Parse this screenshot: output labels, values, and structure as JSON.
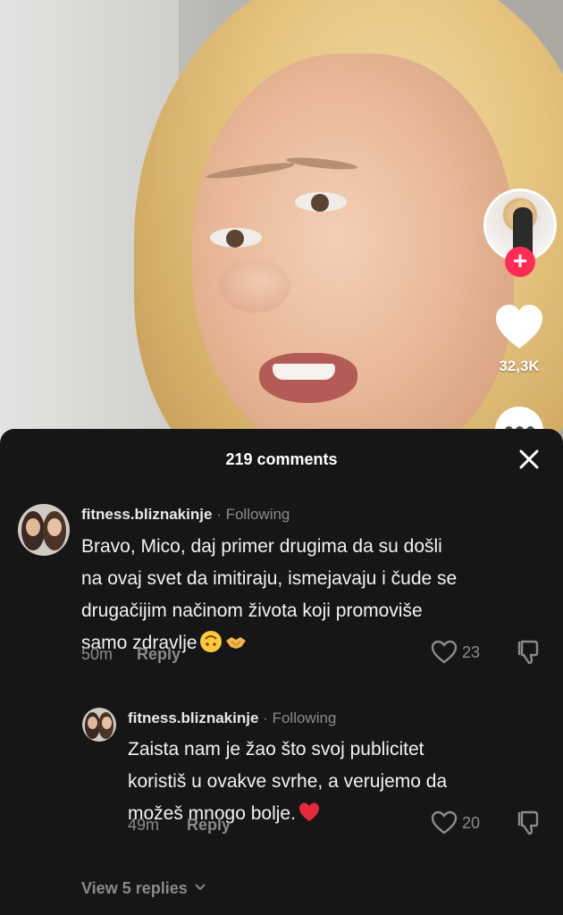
{
  "video": {
    "like_count": "32,3K"
  },
  "comments_sheet": {
    "count_label": "219 comments",
    "comments": [
      {
        "username": "fitness.bliznakinje",
        "separator": "·",
        "relation": "Following",
        "lines": [
          "Bravo, Mico, daj primer drugima da su došli",
          "na ovaj svet da imitiraju, ismejavaju i čude se",
          "drugačijim načinom života koji promoviše",
          "samo zdravlje"
        ],
        "emojis": [
          "upside-down-face",
          "handshake"
        ],
        "time": "50m",
        "reply_label": "Reply",
        "likes": "23"
      },
      {
        "username": "fitness.bliznakinje",
        "separator": "·",
        "relation": "Following",
        "lines": [
          "Zaista nam je žao što svoj publicitet",
          "koristiš u ovakve svrhe, a verujemo da",
          "možeš mnogo bolje."
        ],
        "emojis": [
          "red-heart"
        ],
        "time": "49m",
        "reply_label": "Reply",
        "likes": "20"
      }
    ],
    "view_replies_label": "View 5 replies"
  },
  "colors": {
    "sheet_background": "#161616",
    "follow_accent": "#ff2c55",
    "secondary_text": "#8a8a8a"
  }
}
